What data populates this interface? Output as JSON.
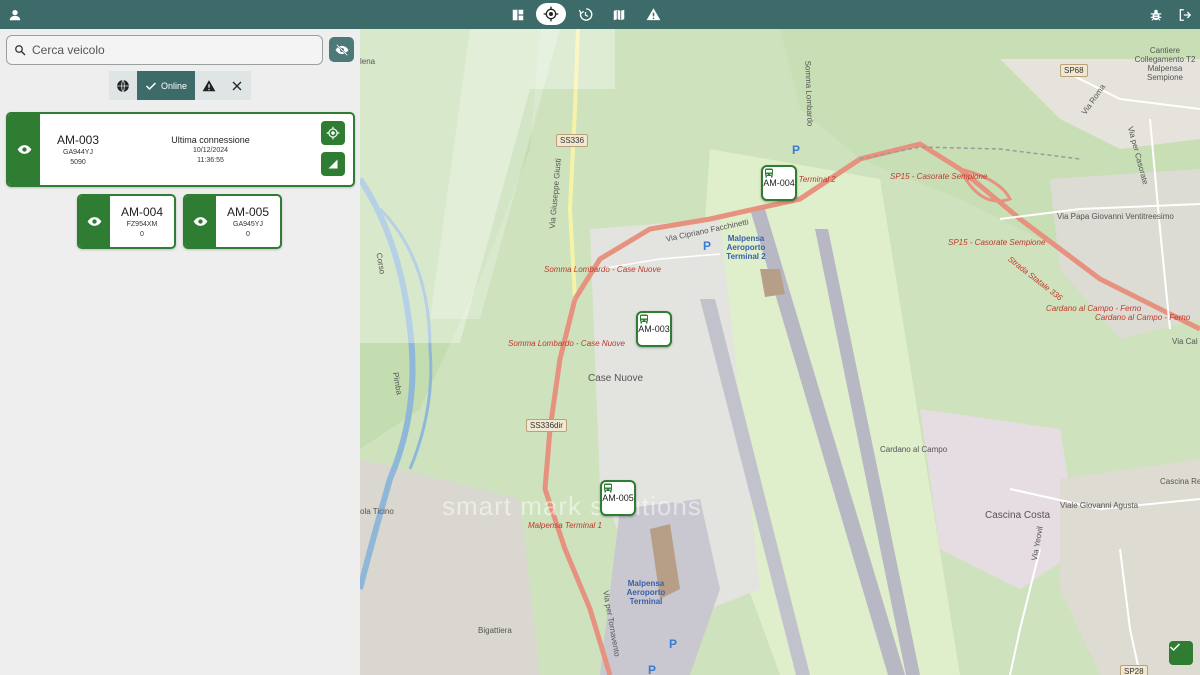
{
  "colors": {
    "topbar": "#3d6b6a",
    "accent_green": "#2f7d32",
    "panel_bg": "#eeeeee"
  },
  "topbar": {
    "left_icon": "person-icon",
    "center_icons": [
      "dashboard-icon",
      "locate-icon",
      "history-icon",
      "map-icon",
      "warning-icon"
    ],
    "active_center": "locate-icon",
    "right_icons": [
      "bug-icon",
      "logout-icon"
    ]
  },
  "search": {
    "placeholder": "Cerca veicolo",
    "value": ""
  },
  "filters": {
    "online_label": "Online",
    "icons": [
      "globe-icon",
      "check-icon",
      "warning-icon",
      "close-icon"
    ],
    "active": "Online"
  },
  "vehicles_panel": {
    "selected": {
      "name": "AM-003",
      "plate": "GA944YJ",
      "odometer": "5090",
      "conn_label": "Ultima connessione",
      "conn_date": "10/12/2024",
      "conn_time": "11:36:55"
    },
    "others": [
      {
        "name": "AM-004",
        "plate": "FZ954XM",
        "odometer": "0"
      },
      {
        "name": "AM-005",
        "plate": "GA945YJ",
        "odometer": "0"
      }
    ]
  },
  "map": {
    "markers": [
      "AM-004",
      "AM-003",
      "AM-005"
    ],
    "watermark": "smart mark solutions",
    "labels": {
      "sp68": "SP68",
      "ss336": "SS336",
      "ss336dir": "SS336dir",
      "sp28": "SP28",
      "cantiere": "Cantiere Collegamento T2 Malpensa Sempione",
      "t2_road": "a Terminal 2",
      "sp15a": "SP15 - Casorate Sempione",
      "sp15b": "SP15 - Casorate Sempione",
      "venti": "Via Papa Giovanni Ventitreesimo",
      "giuseppe": "Via Giuseppe Giusti",
      "cipriano": "Via Cipriano Facchinetti",
      "terminal2": "Malpensa Aeroporto Terminal 2",
      "somma1": "Somma Lombardo - Case Nuove",
      "somma2": "Somma Lombardo - Case Nuove",
      "casenuove": "Case Nuove",
      "cardano1": "Cardano al Campo - Ferno",
      "cardano2": "Cardano al Campo - Ferno",
      "cardano3": "Cardano al Campo",
      "statale": "Strada Statale 336",
      "cascinacosta": "Cascina Costa",
      "cascinare": "Cascina Re",
      "agusta": "Viale Giovanni Agusta",
      "terminal1": "Malpensa Terminal 1",
      "aeroT1": "Malpensa Aeroporto Terminal",
      "bigattiera": "Bigattiera",
      "ticino": "ola Ticino",
      "lena": "lena",
      "viaroma": "Via Roma",
      "viacal": "Via Cal",
      "viacasorate": "Via per Casorate",
      "viayeo": "Via Yeovil",
      "viaferno": "Via per Tornavento",
      "sommalomb": "Somma Lombardo",
      "pimba": "Pimba",
      "corso": "Corso",
      "p1": "P",
      "p2": "P",
      "p3": "P",
      "p4": "P"
    }
  }
}
